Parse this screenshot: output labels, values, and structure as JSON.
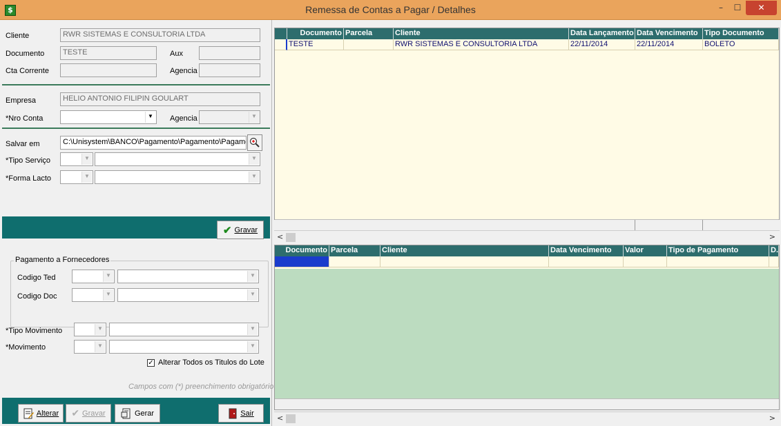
{
  "window": {
    "title": "Remessa de Contas a Pagar / Detalhes",
    "icon": "dollar-icon",
    "min": "–",
    "max": "☐",
    "close": "✕"
  },
  "titular": {
    "cliente_label": "Cliente",
    "cliente_value": "RWR SISTEMAS E CONSULTORIA LTDA",
    "documento_label": "Documento",
    "documento_value": "TESTE",
    "aux_label": "Aux",
    "aux_value": "",
    "cta_label": "Cta Corrente",
    "cta_value": "",
    "agencia_label": "Agencia",
    "agencia_value": ""
  },
  "empresa": {
    "empresa_label": "Empresa",
    "empresa_value": "HELIO ANTONIO FILIPIN GOULART",
    "nro_conta_label": "*Nro Conta",
    "nro_conta_value": "",
    "agencia_label": "Agencia",
    "agencia_value": ""
  },
  "arquivo": {
    "salvar_label": "Salvar em",
    "salvar_value": "C:\\Unisystem\\BANCO\\Pagamento\\Pagamento\\Pagamer",
    "tipo_servico_label": "*Tipo Serviço",
    "forma_lacto_label": "*Forma Lacto",
    "gravar_label": "Gravar"
  },
  "fornecedores": {
    "legend": "Pagamento a Fornecedores",
    "ted_label": "Codigo Ted",
    "doc_label": "Codigo Doc"
  },
  "movimento": {
    "tipo_label": "*Tipo Movimento",
    "mov_label": "*Movimento",
    "alterar_todos_label": "Alterar Todos os Titulos do Lote",
    "alterar_todos_checked": true,
    "note": "Campos com (*) preenchimento obrigatório"
  },
  "actions": {
    "alterar": "Alterar",
    "gravar": "Gravar",
    "gerar": "Gerar",
    "sair": "Sair"
  },
  "grid1": {
    "columns": [
      "Documento",
      "Parcela",
      "Cliente",
      "Data Lançamento",
      "Data Vencimento",
      "Tipo Documento"
    ],
    "rows": [
      [
        "TESTE",
        "",
        "RWR SISTEMAS E CONSULTORIA LTDA",
        "22/11/2014",
        "22/11/2014",
        "BOLETO"
      ]
    ],
    "bg": "#fffbe6"
  },
  "grid2": {
    "columns": [
      "Documento",
      "Parcela",
      "Cliente",
      "Data Vencimento",
      "Valor",
      "Tipo de Pagamento",
      "D..."
    ],
    "rows": [
      [
        "",
        "",
        "",
        "",
        "",
        "",
        ""
      ]
    ],
    "bg": "#bcdcc0"
  },
  "colors": {
    "header": "#2d6d6d",
    "accent": "#0f6e6e",
    "selection": "#1a3ccc"
  }
}
